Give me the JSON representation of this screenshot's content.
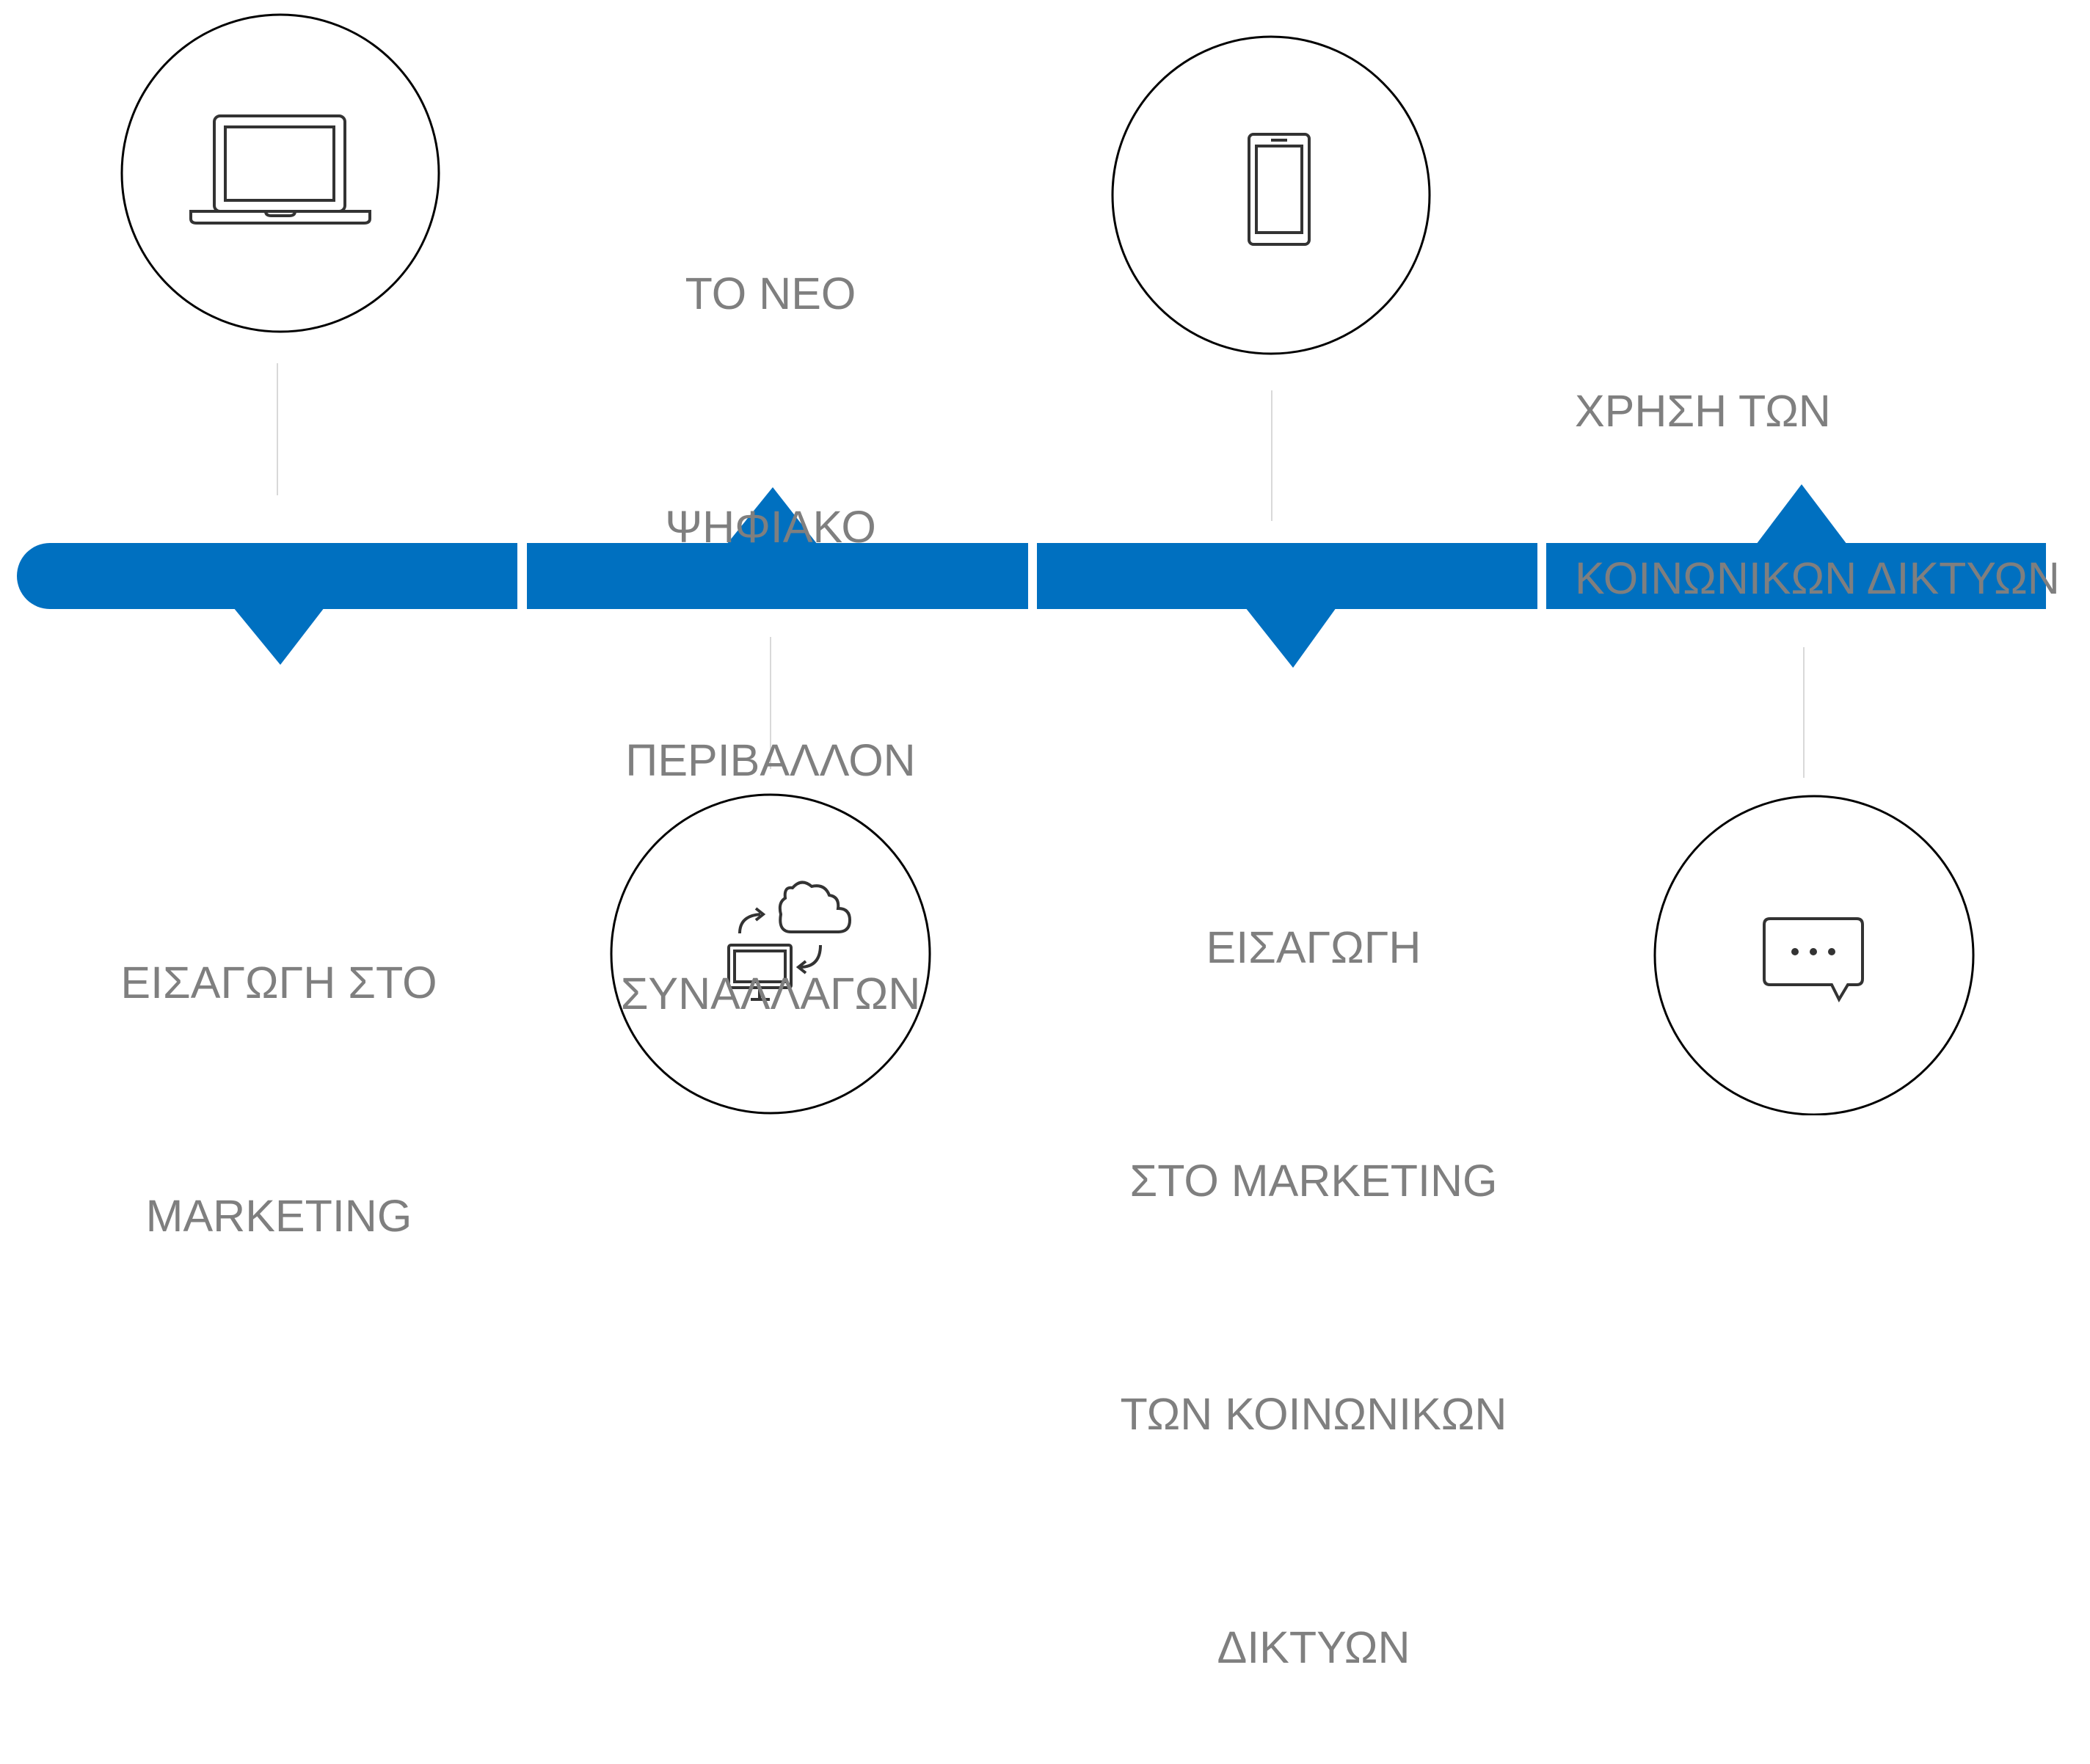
{
  "diagram": {
    "colors": {
      "bar": "#0070c0",
      "circle_stroke": "#000000",
      "connector": "#d9d9d9",
      "icon": "#333333",
      "text": "#7f7f7f"
    },
    "milestones": [
      {
        "position": "above",
        "icon": "laptop-icon",
        "lines": [
          "ΕΙΣΑΓΩΓΗ ΣΤΟ",
          "MARKETING"
        ]
      },
      {
        "position": "below",
        "icon": "cloud-sync-icon",
        "lines": [
          "ΤΟ ΝΕΟ",
          "ΨΗΦΙΑΚΟ",
          "ΠΕΡΙΒΑΛΛΟΝ",
          "ΣΥΝΑΛΛΑΓΩΝ"
        ]
      },
      {
        "position": "above",
        "icon": "smartphone-icon",
        "lines": [
          "ΕΙΣΑΓΩΓΗ",
          "ΣΤΟ MARKETING",
          "ΤΩΝ ΚΟΙΝΩΝΙΚΩΝ",
          "ΔΙΚΤΥΩΝ"
        ]
      },
      {
        "position": "below",
        "icon": "chat-bubble-icon",
        "lines": [
          "ΧΡΗΣΗ ΤΩΝ",
          "ΚΟΙΝΩΝΙΚΩΝ ΔΙΚΤΥΩΝ"
        ]
      }
    ]
  }
}
